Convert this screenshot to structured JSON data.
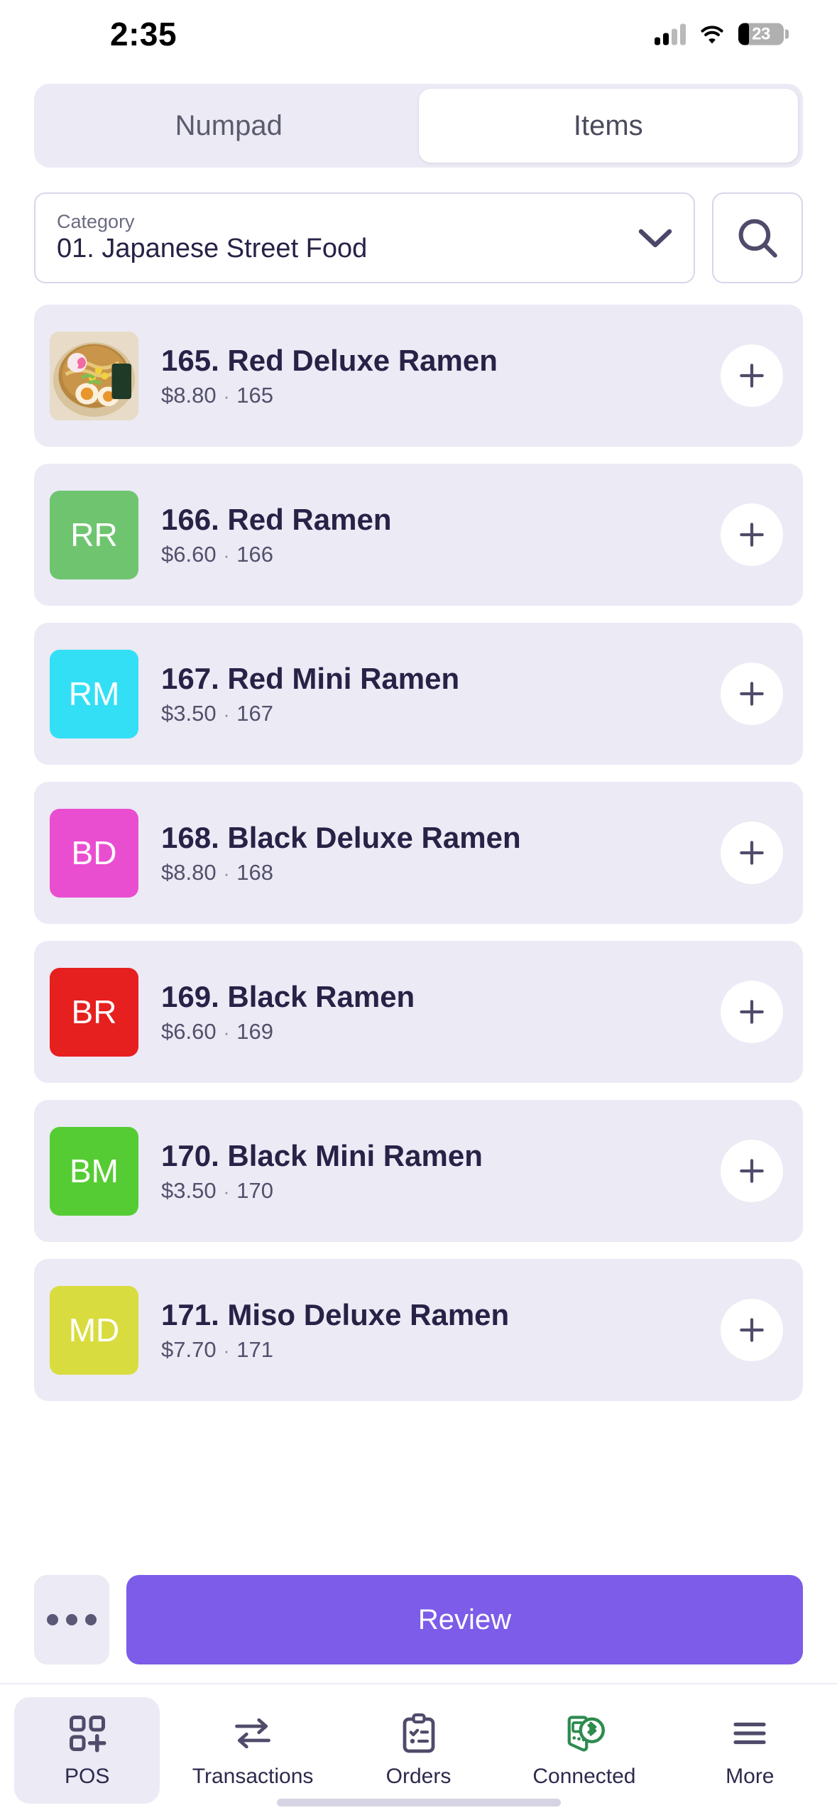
{
  "status_bar": {
    "time": "2:35",
    "battery_percent": "23",
    "signal_bars_filled": 2,
    "signal_bars_total": 4,
    "wifi_icon": "wifi-icon",
    "battery_icon": "battery-icon"
  },
  "segmented_control": {
    "tabs": [
      {
        "label": "Numpad",
        "active": false
      },
      {
        "label": "Items",
        "active": true
      }
    ]
  },
  "category": {
    "label": "Category",
    "value": "01. Japanese Street Food",
    "chevron_icon": "chevron-down-icon",
    "search_icon": "search-icon"
  },
  "items": [
    {
      "name": "165. Red Deluxe Ramen",
      "price": "$8.80",
      "separator": "·",
      "code": "165",
      "thumb_type": "photo",
      "initials": "",
      "color": "#cbb79a",
      "add_icon": "plus-icon"
    },
    {
      "name": "166. Red Ramen",
      "price": "$6.60",
      "separator": "·",
      "code": "166",
      "thumb_type": "initials",
      "initials": "RR",
      "color": "#6fc56f",
      "add_icon": "plus-icon"
    },
    {
      "name": "167. Red Mini Ramen",
      "price": "$3.50",
      "separator": "·",
      "code": "167",
      "thumb_type": "initials",
      "initials": "RM",
      "color": "#33dff5",
      "add_icon": "plus-icon"
    },
    {
      "name": "168. Black Deluxe Ramen",
      "price": "$8.80",
      "separator": "·",
      "code": "168",
      "thumb_type": "initials",
      "initials": "BD",
      "color": "#ea4ed0",
      "add_icon": "plus-icon"
    },
    {
      "name": "169. Black Ramen",
      "price": "$6.60",
      "separator": "·",
      "code": "169",
      "thumb_type": "initials",
      "initials": "BR",
      "color": "#e61f1f",
      "add_icon": "plus-icon"
    },
    {
      "name": "170. Black Mini Ramen",
      "price": "$3.50",
      "separator": "·",
      "code": "170",
      "thumb_type": "initials",
      "initials": "BM",
      "color": "#56cc34",
      "add_icon": "plus-icon"
    },
    {
      "name": "171. Miso Deluxe Ramen",
      "price": "$7.70",
      "separator": "·",
      "code": "171",
      "thumb_type": "initials",
      "initials": "MD",
      "color": "#d9dc3e",
      "add_icon": "plus-icon"
    }
  ],
  "action_bar": {
    "more_icon": "ellipsis-icon",
    "review_label": "Review",
    "review_color": "#7c5ce8"
  },
  "tab_bar": {
    "tabs": [
      {
        "label": "POS",
        "icon": "grid-plus-icon",
        "active": true
      },
      {
        "label": "Transactions",
        "icon": "transfer-arrows-icon",
        "active": false
      },
      {
        "label": "Orders",
        "icon": "clipboard-check-icon",
        "active": false
      },
      {
        "label": "Connected",
        "icon": "bluetooth-printer-icon",
        "active": false,
        "color": "#2e8b4f"
      },
      {
        "label": "More",
        "icon": "hamburger-icon",
        "active": false
      }
    ]
  }
}
